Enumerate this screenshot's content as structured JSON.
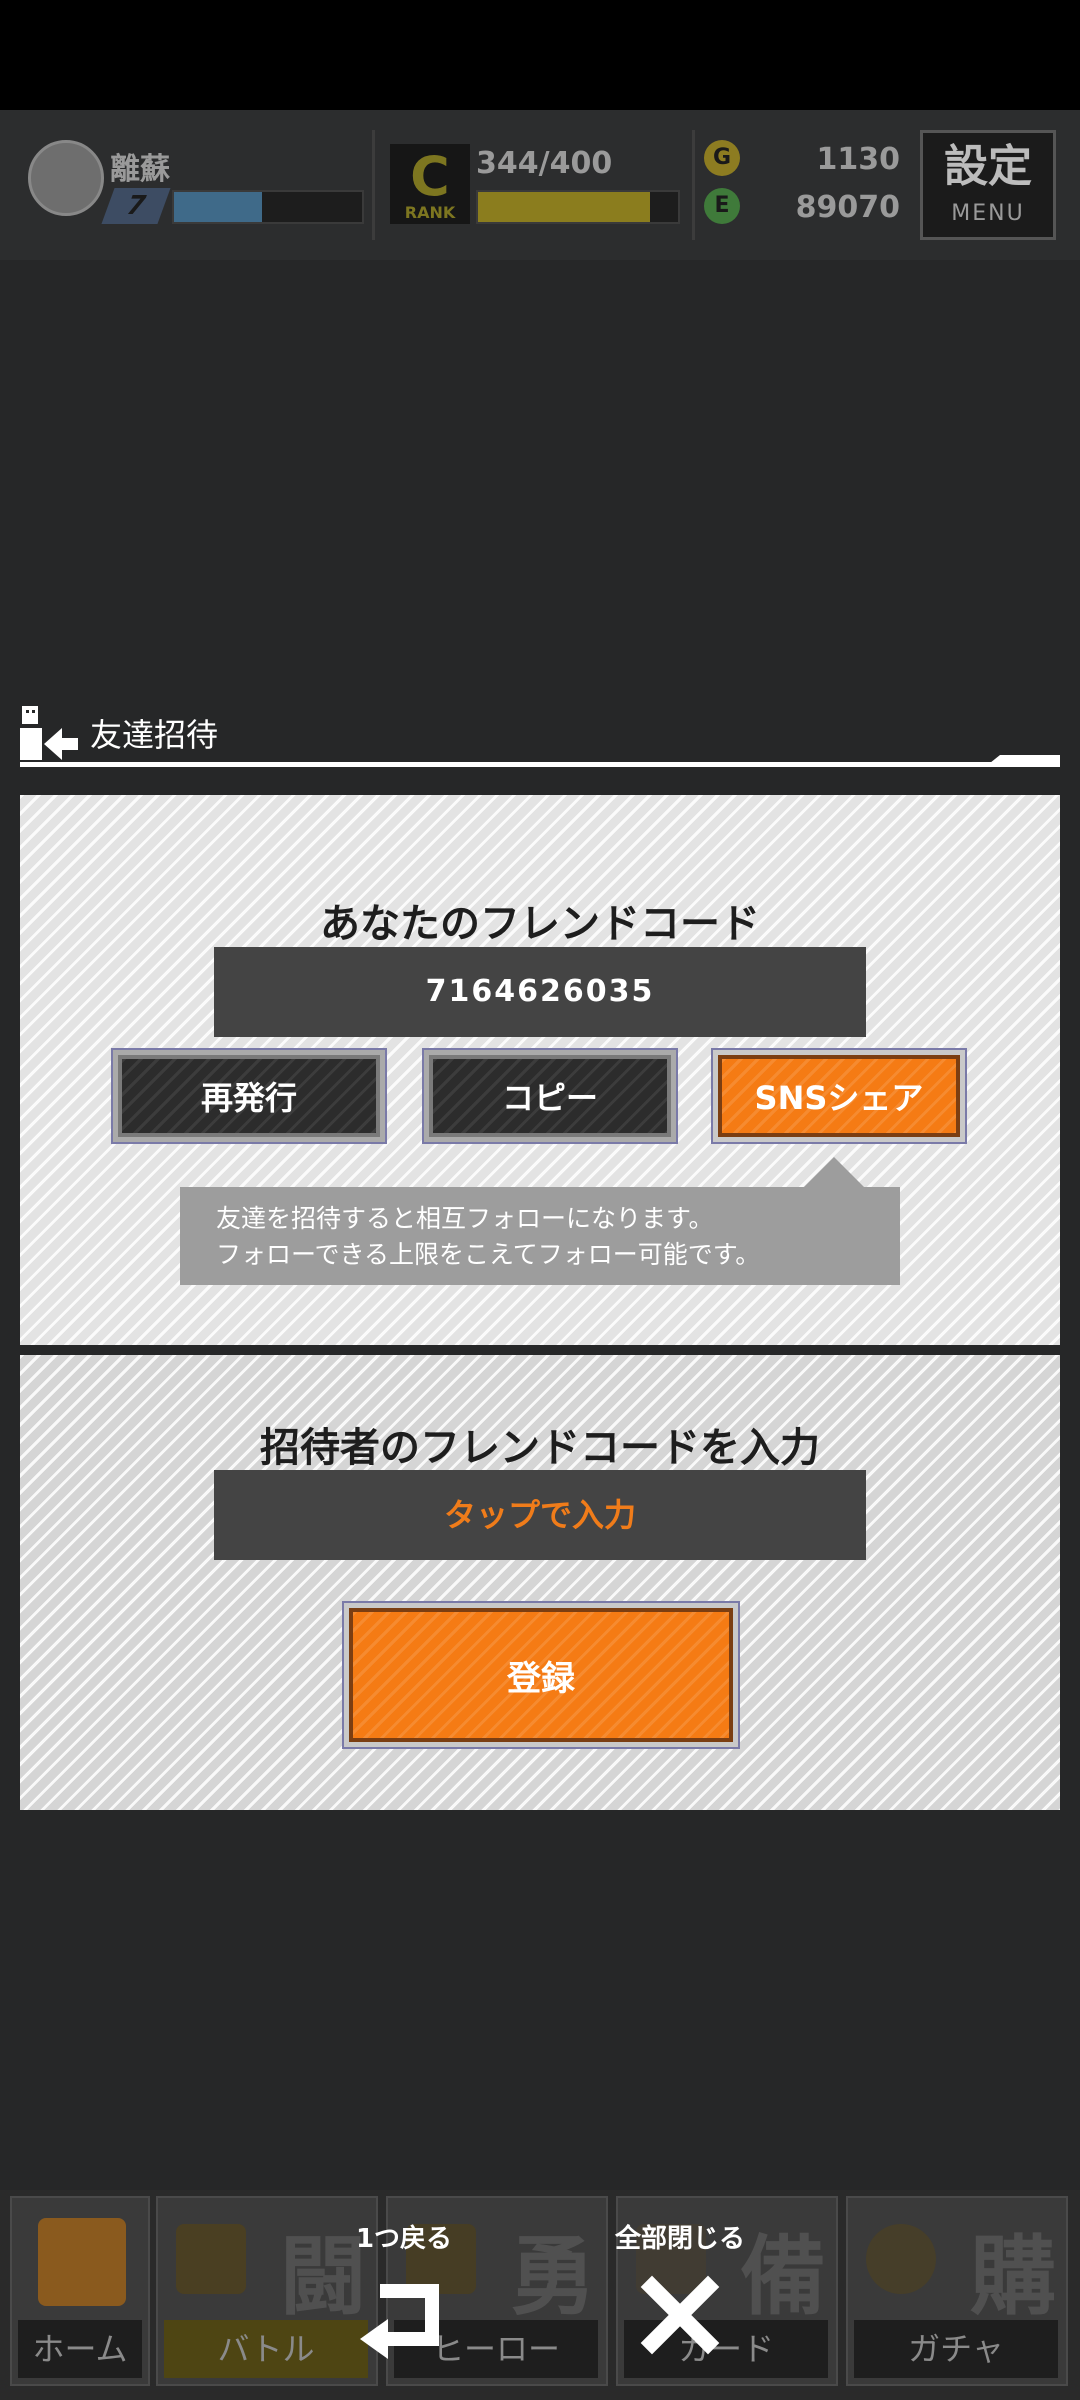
{
  "hud": {
    "player_name": "離蘇",
    "level": "7",
    "exp_fraction": 0.47,
    "rank_letter": "C",
    "rank_label": "RANK",
    "stamina": "344/400",
    "stamina_fraction": 0.86,
    "gold_coin_letter": "G",
    "gold": "1130",
    "energy_coin_letter": "E",
    "energy": "89070",
    "settings_kanji": "設定",
    "settings_menu": "MENU"
  },
  "dialog": {
    "title": "友達招待",
    "own_code_section": {
      "heading": "あなたのフレンドコード",
      "code": "7164626035",
      "reissue_label": "再発行",
      "copy_label": "コピー",
      "share_label": "SNSシェア",
      "tooltip_line1": "友達を招待すると相互フォローになります。",
      "tooltip_line2": "フォローできる上限をこえてフォロー可能です。"
    },
    "inviter_section": {
      "heading": "招待者のフレンドコードを入力",
      "input_placeholder": "タップで入力",
      "register_label": "登録"
    }
  },
  "tabbar": {
    "tabs": [
      {
        "label": "ホーム",
        "kanji": ""
      },
      {
        "label": "バトル",
        "kanji": "闘"
      },
      {
        "label": "ヒーロー",
        "kanji": "勇"
      },
      {
        "label": "カード",
        "kanji": "備"
      },
      {
        "label": "ガチャ",
        "kanji": "購"
      }
    ]
  },
  "overlay_nav": {
    "back_label": "1つ戻る",
    "close_all_label": "全部閉じる"
  },
  "colors": {
    "accent_orange": "#f57b14",
    "dark_button": "#2c2c2c",
    "panel_bg": "#e3e3e3",
    "placeholder_orange": "#f07c1a"
  }
}
